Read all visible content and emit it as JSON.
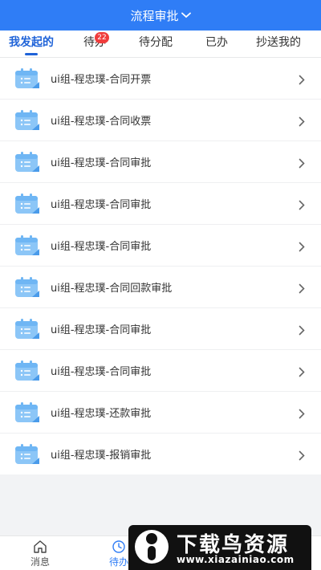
{
  "header": {
    "title": "流程审批",
    "dropdown_icon": "chevron-down-icon"
  },
  "tabs": [
    {
      "label": "我发起的",
      "active": true
    },
    {
      "label": "待办",
      "badge": "22"
    },
    {
      "label": "待分配"
    },
    {
      "label": "已办"
    },
    {
      "label": "抄送我的"
    }
  ],
  "list_icon": "calendar-list-icon",
  "items": [
    {
      "title": "ui组-程忠璞-合同开票"
    },
    {
      "title": "ui组-程忠璞-合同收票"
    },
    {
      "title": "ui组-程忠璞-合同审批"
    },
    {
      "title": "ui组-程忠璞-合同审批"
    },
    {
      "title": "ui组-程忠璞-合同审批"
    },
    {
      "title": "ui组-程忠璞-合同回款审批"
    },
    {
      "title": "ui组-程忠璞-合同审批"
    },
    {
      "title": "ui组-程忠璞-合同审批"
    },
    {
      "title": "ui组-程忠璞-还款审批"
    },
    {
      "title": "ui组-程忠璞-报销审批"
    }
  ],
  "bottom_nav": [
    {
      "label": "消息",
      "icon": "home-icon"
    },
    {
      "label": "待办",
      "icon": "clock-icon",
      "active": true
    }
  ],
  "watermark": {
    "title": "下载鸟资源",
    "url": "www.xiazainiao.com"
  },
  "colors": {
    "primary": "#2f7df6",
    "active_tab": "#1f63d8",
    "badge": "#f03c3c"
  }
}
